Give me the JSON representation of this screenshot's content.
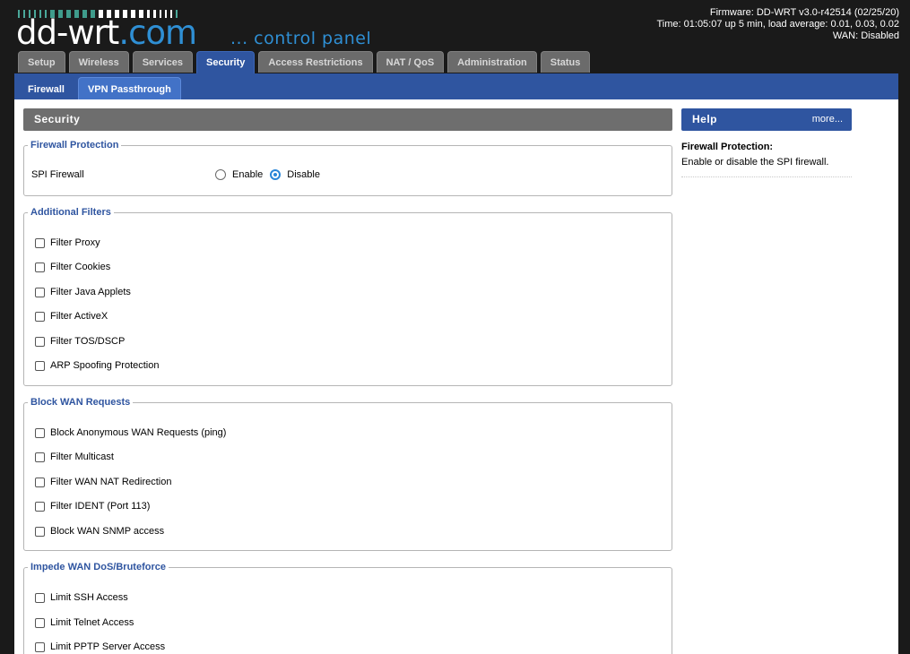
{
  "header": {
    "logo_main": "dd-wrt",
    "logo_suffix": ".com",
    "subtitle": "... control panel",
    "firmware": "Firmware: DD-WRT v3.0-r42514 (02/25/20)",
    "time": "Time: 01:05:07 up 5 min, load average: 0.01, 0.03, 0.02",
    "wan": "WAN: Disabled"
  },
  "main_tabs": [
    "Setup",
    "Wireless",
    "Services",
    "Security",
    "Access Restrictions",
    "NAT / QoS",
    "Administration",
    "Status"
  ],
  "sub_tabs": [
    "Firewall",
    "VPN Passthrough"
  ],
  "section_title": "Security",
  "firewall_protection": {
    "legend": "Firewall Protection",
    "label": "SPI Firewall",
    "enable": "Enable",
    "disable": "Disable",
    "selected": "Disable"
  },
  "additional_filters": {
    "legend": "Additional Filters",
    "items": [
      "Filter Proxy",
      "Filter Cookies",
      "Filter Java Applets",
      "Filter ActiveX",
      "Filter TOS/DSCP",
      "ARP Spoofing Protection"
    ]
  },
  "block_wan": {
    "legend": "Block WAN Requests",
    "items": [
      "Block Anonymous WAN Requests (ping)",
      "Filter Multicast",
      "Filter WAN NAT Redirection",
      "Filter IDENT (Port 113)",
      "Block WAN SNMP access"
    ]
  },
  "impede_wan": {
    "legend": "Impede WAN DoS/Bruteforce",
    "items": [
      "Limit SSH Access",
      "Limit Telnet Access",
      "Limit PPTP Server Access"
    ]
  },
  "help": {
    "title": "Help",
    "more": "more...",
    "topic": "Firewall Protection:",
    "text": "Enable or disable the SPI firewall."
  },
  "colors": {
    "accent": "#2f55a0",
    "logo_blue": "#2f8fd4",
    "section_gray": "#6e6e6e"
  }
}
